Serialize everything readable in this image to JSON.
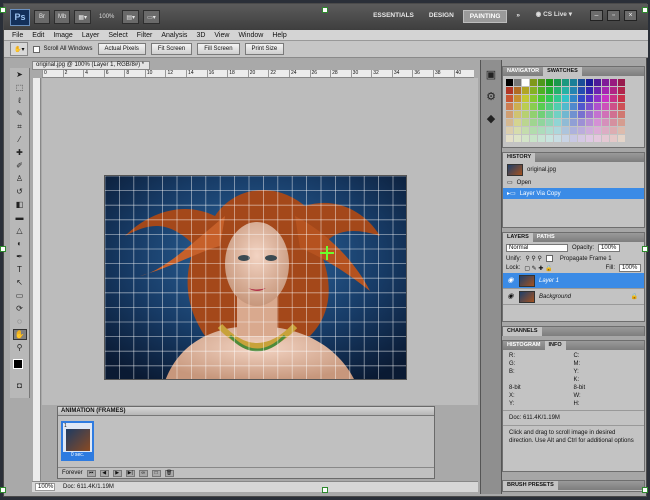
{
  "app": {
    "logo": "Ps",
    "zoom": "100%",
    "workspaces": [
      "ESSENTIALS",
      "DESIGN",
      "PAINTING"
    ],
    "active_workspace": "PAINTING",
    "overflow": "»",
    "cs_live": "CS Live"
  },
  "menu": [
    "File",
    "Edit",
    "Image",
    "Layer",
    "Select",
    "Filter",
    "Analysis",
    "3D",
    "View",
    "Window",
    "Help"
  ],
  "options_bar": {
    "scroll_all_windows": "Scroll All Windows",
    "buttons": [
      "Actual Pixels",
      "Fit Screen",
      "Fill Screen",
      "Print Size"
    ]
  },
  "document": {
    "tab_title": "original.jpg @ 100% (Layer 1, RGB/8#) *",
    "ruler_marks": [
      "0",
      "2",
      "4",
      "6",
      "8",
      "10",
      "12",
      "14",
      "16",
      "18",
      "20",
      "22",
      "24",
      "26",
      "28",
      "30",
      "32",
      "34",
      "36",
      "38",
      "40"
    ]
  },
  "animation_panel": {
    "title": "ANIMATION (FRAMES)",
    "frame_number": "1",
    "frame_delay": "0 sec.",
    "loop": "Forever"
  },
  "status_bar": {
    "zoom": "100%",
    "doc_size": "Doc: 611.4K/1.19M"
  },
  "panels": {
    "swatch_tabs": [
      "NAVIGATOR",
      "SWATCHES"
    ],
    "history": {
      "title": "HISTORY",
      "snapshot": "original.jpg",
      "steps": [
        "Open",
        "Layer Via Copy"
      ]
    },
    "layers": {
      "tabs": [
        "LAYERS",
        "PATHS"
      ],
      "blend_mode": "Normal",
      "opacity_label": "Opacity:",
      "opacity_value": "100%",
      "unify_label": "Unify:",
      "propagate": "Propagate Frame 1",
      "lock_label": "Lock:",
      "fill_label": "Fill:",
      "fill_value": "100%",
      "items": [
        "Layer 1",
        "Background"
      ]
    },
    "channels": "CHANNELS",
    "info": {
      "tabs": [
        "HISTOGRAM",
        "INFO"
      ],
      "rgb": [
        "R:",
        "G:",
        "B:"
      ],
      "cmyk": [
        "C:",
        "M:",
        "Y:",
        "K:"
      ],
      "bit_left": "8-bit",
      "bit_right": "8-bit",
      "xy": [
        "X:",
        "Y:"
      ],
      "wh": [
        "W:",
        "H:"
      ],
      "doc": "Doc: 611.4K/1.19M",
      "hint": "Click and drag to scroll image in desired direction. Use Alt and Ctrl for additional options"
    },
    "brush_presets": "BRUSH PRESETS"
  },
  "colors": {
    "accent": "#3b8be6",
    "photo_background": "#1d4a7a",
    "hair": "#b8521f",
    "grid": "#ffffff",
    "cursor": "#6cff2c"
  }
}
